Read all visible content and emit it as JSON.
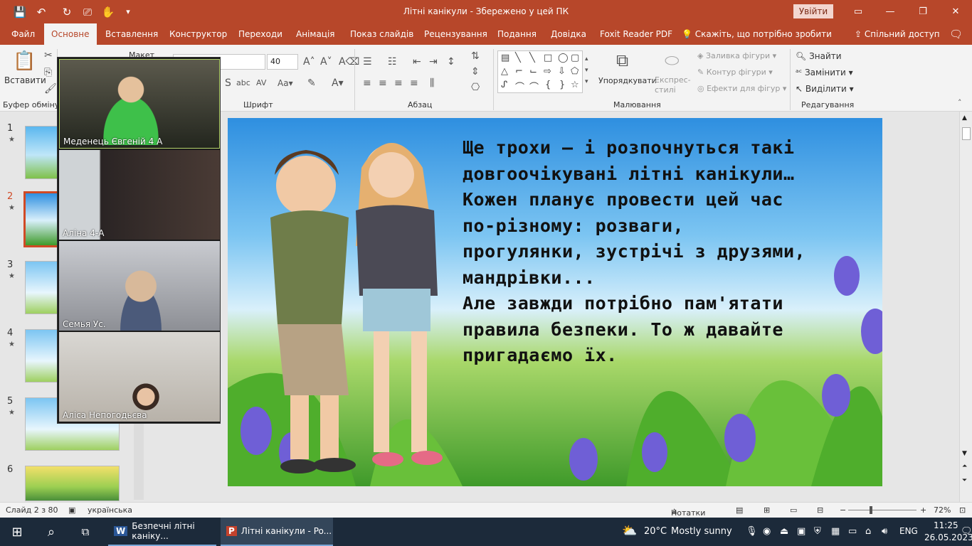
{
  "window": {
    "title": "Літні канікули  -  Збережено у цей ПК",
    "signin_label": "Увійти"
  },
  "tabs": [
    "Файл",
    "Основне",
    "Вставлення",
    "Конструктор",
    "Переходи",
    "Анімація",
    "Показ слайдів",
    "Рецензування",
    "Подання",
    "Довідка",
    "Foxit Reader PDF"
  ],
  "tell_me": "Скажіть, що потрібно зробити",
  "share_label": "Спільний доступ",
  "ribbon": {
    "paste": "Вставити",
    "clipboard_group": "Буфер обміну",
    "layout_label": "Макет",
    "font_group": "Шрифт",
    "font_size": "40",
    "paragraph_group": "Абзац",
    "arrange": "Упорядкувати",
    "quick_styles": "Експрес-стилі",
    "shape_fill": "Заливка фігури",
    "shape_outline": "Контур фігури",
    "shape_effects": "Ефекти для фігур",
    "drawing_group": "Малювання",
    "find": "Знайти",
    "replace": "Замінити",
    "select": "Виділити",
    "editing_group": "Редагування"
  },
  "thumbnails": [
    {
      "num": "1",
      "star": "★"
    },
    {
      "num": "2",
      "star": "★"
    },
    {
      "num": "3",
      "star": "★"
    },
    {
      "num": "4",
      "star": "★"
    },
    {
      "num": "5",
      "star": "★"
    },
    {
      "num": "6",
      "star": ""
    }
  ],
  "slide": {
    "lines": [
      "Ще трохи — і розпочнуться такі",
      "довгоочікувані літні канікули…",
      "Кожен планує провести цей час",
      "по-різному: розваги,",
      "прогулянки, зустрічі з друзями,",
      "мандрівки...",
      "Але завжди потрібно пам'ятати",
      "правила безпеки. То ж давайте",
      "пригадаємо їх."
    ]
  },
  "zoom_participants": [
    {
      "name": "Меденець Євгеній 4 А"
    },
    {
      "name": "Аліна 4-А"
    },
    {
      "name": "Семья Ус."
    },
    {
      "name": "Аліса Непогодьєва"
    }
  ],
  "status": {
    "slide_info": "Слайд 2 з 80",
    "language": "українська",
    "notes": "Нотатки",
    "zoom_level": "72%"
  },
  "taskbar": {
    "apps": [
      {
        "label": "Безпечні літні каніку..."
      },
      {
        "label": "Літні канікули - Po..."
      }
    ],
    "weather_temp": "20°C",
    "weather_text": "Mostly sunny",
    "input_lang": "ENG",
    "time": "11:25",
    "date": "26.05.2023"
  },
  "colors": {
    "accent": "#b7472a",
    "thumb_selected": "#d04a26"
  }
}
